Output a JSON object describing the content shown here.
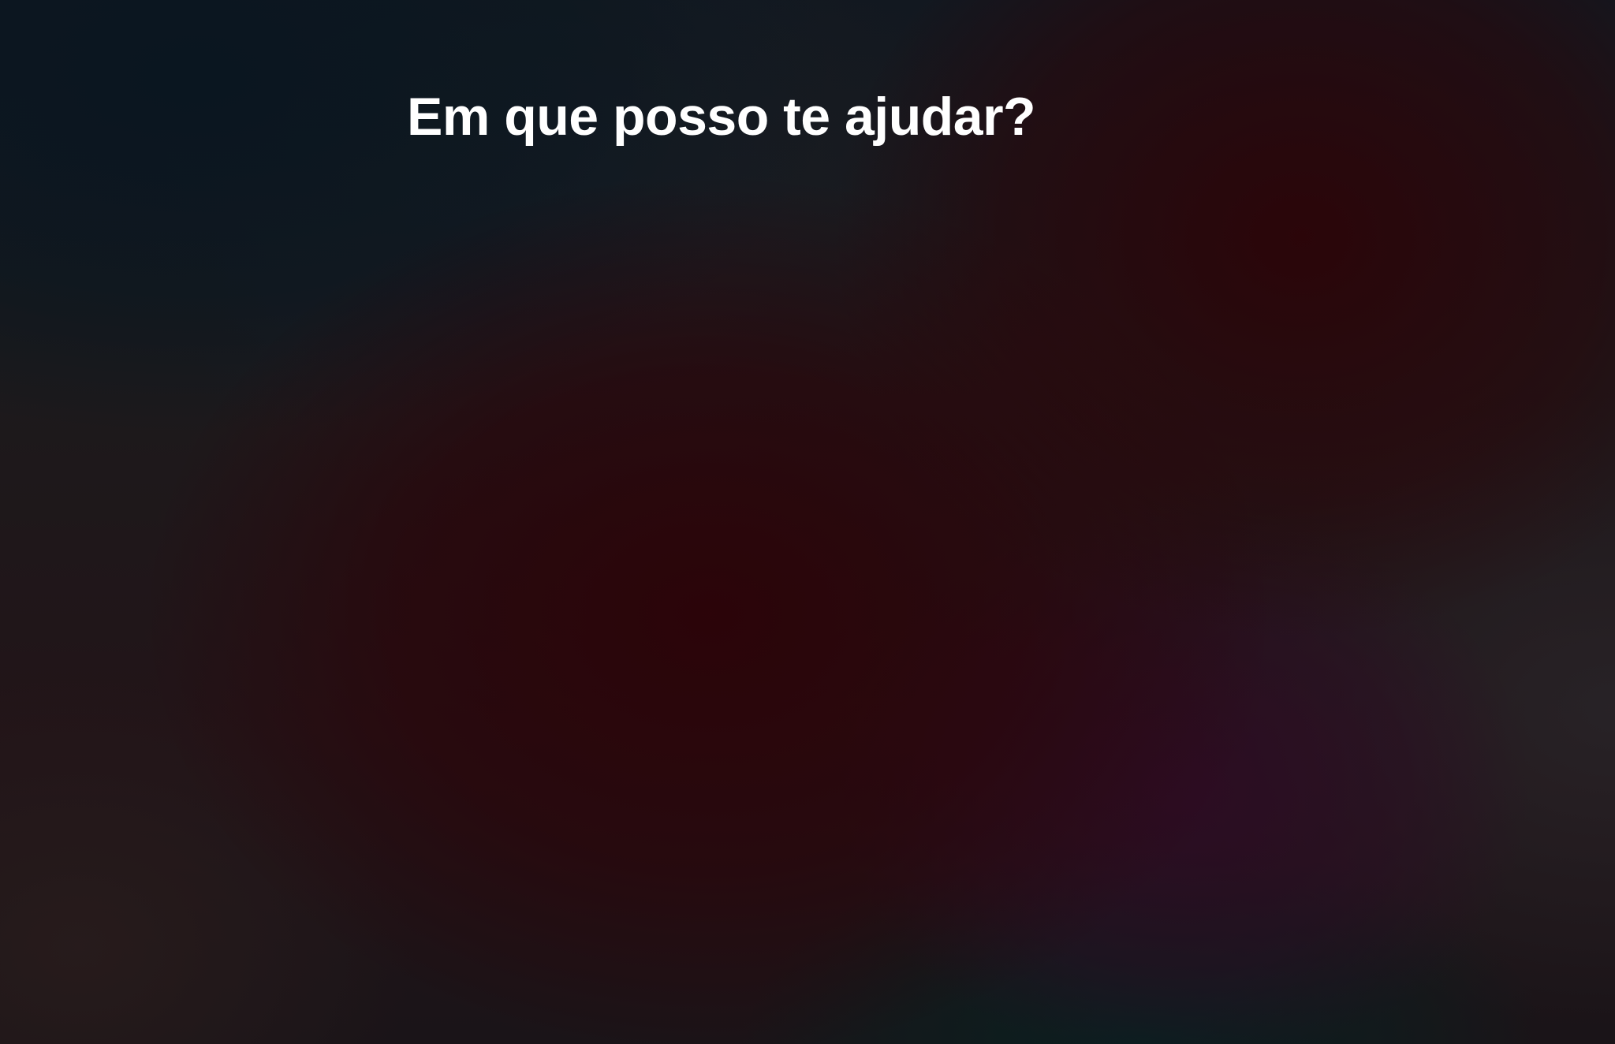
{
  "siri": {
    "prompt_text": "Em que posso te ajudar?"
  }
}
